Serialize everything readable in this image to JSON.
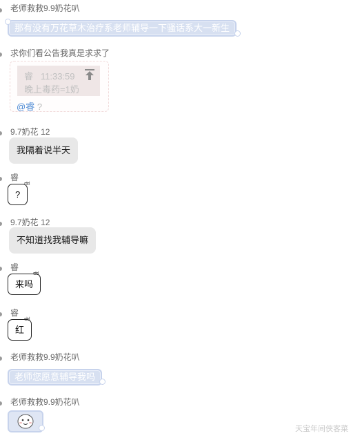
{
  "messages": [
    {
      "sender": "老师救救9.9奶花叭",
      "text": "那有没有万花草木治疗系老师辅导一下骚话系大一新生"
    },
    {
      "sender": "求你们看公告我真是求求了",
      "quote": {
        "author": "睿",
        "time": "11:33:59",
        "text": "晚上毒药=1奶"
      },
      "mention": "@睿",
      "mention_suffix": "?"
    },
    {
      "sender": "9.7奶花 12",
      "text": "我隔着说半天"
    },
    {
      "sender": "睿",
      "text": "?"
    },
    {
      "sender": "9.7奶花 12",
      "text": "不知道找我辅导嘛"
    },
    {
      "sender": "睿",
      "text": "来吗"
    },
    {
      "sender": "睿",
      "text": "红"
    },
    {
      "sender": "老师救救9.9奶花叭",
      "text": "老师您愿意辅导我吗"
    },
    {
      "sender": "老师救救9.9奶花叭",
      "sticker": "face-sticker-icon"
    }
  ],
  "speech_eyes": "ಠಠ",
  "watermark": "天宝年间侠客菜",
  "colors": {
    "cloud_fill": "#d7e0f1",
    "cloud_border": "#c7d3ec",
    "gray_bubble": "#e8e8e8",
    "mention": "#4a88d4"
  }
}
